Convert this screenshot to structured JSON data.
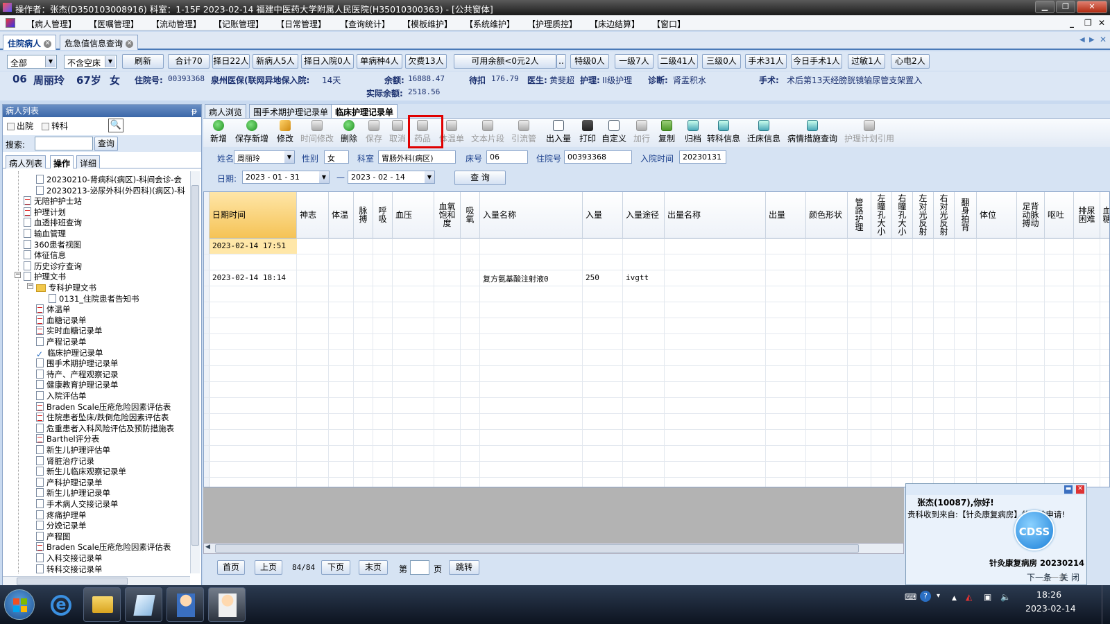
{
  "window": {
    "title": "操作者：张杰(D350103008916)  科室：1-15F  2023-02-14  福建中医药大学附属人民医院(H35010300363) - [公共窗体]",
    "controls": [
      "minimize",
      "restore",
      "close"
    ]
  },
  "menu": {
    "items": [
      "【病人管理】",
      "【医嘱管理】",
      "【流动管理】",
      "【记账管理】",
      "【日常管理】",
      "【查询统计】",
      "【模板维护】",
      "【系统维护】",
      "【护理质控】",
      "【床边结算】",
      "【窗口】"
    ],
    "right_controls": [
      "_",
      "❐",
      "✕"
    ]
  },
  "top_tabs": [
    {
      "label": "住院病人",
      "active": true
    },
    {
      "label": "危急值信息查询",
      "active": false
    }
  ],
  "filter": {
    "scope_value": "全部",
    "bed_value": "不含空床",
    "buttons": [
      "刷新",
      "合计70",
      "择日22人",
      "新病人5人",
      "择日入院0人",
      "单病种4人",
      "欠费13人",
      "可用余额<0元2人",
      "..",
      "特级0人",
      "一级7人",
      "二级41人",
      "三级0人",
      "手术31人",
      "今日手术1人",
      "过敏1人",
      "心电2人"
    ]
  },
  "patient": {
    "bed": "06",
    "name": "周丽玲",
    "age": "67岁",
    "sex": "女",
    "admission_no_label": "住院号:",
    "admission_no": "00393368",
    "insurance": "泉州医保(联网异地保入院:",
    "days": "14天",
    "balance_label": "余额:",
    "balance": "16888.47",
    "pending_label": "待扣",
    "pending": "176.79",
    "actual_balance_label": "实际余额:",
    "actual_balance": "2518.56",
    "doctor_label": "医生:",
    "doctor": "黄斐超",
    "nursing_label": "护理:",
    "nursing": "II级护理",
    "diagnosis_label": "诊断:",
    "diagnosis": "肾盂积水",
    "surgery_label": "手术:",
    "surgery": "术后第13天经膀胱镜输尿管支架置入"
  },
  "left_panel": {
    "header": "病人列表",
    "pin": "ᵽ",
    "discharged_label": "出院",
    "transfer_label": "转科",
    "search_label": "搜索:",
    "search_value": "",
    "query_button": "查询",
    "tabs": [
      {
        "label": "病人列表",
        "active": false
      },
      {
        "label": "操作",
        "active": true
      },
      {
        "label": "详细",
        "active": false
      }
    ],
    "tree": [
      {
        "label": "20230210-肾病科(病区)-科间会诊-会",
        "level": 2,
        "icon": "doc"
      },
      {
        "label": "20230213-泌尿外科(外四科)(病区)-科",
        "level": 2,
        "icon": "doc"
      },
      {
        "label": "无陪护护士站",
        "level": 1,
        "icon": "red"
      },
      {
        "label": "护理计划",
        "level": 1,
        "icon": "red"
      },
      {
        "label": "血透排班查询",
        "level": 1,
        "icon": "doc"
      },
      {
        "label": "输血管理",
        "level": 1,
        "icon": "doc"
      },
      {
        "label": "360患者视图",
        "level": 1,
        "icon": "doc"
      },
      {
        "label": "体征信息",
        "level": 1,
        "icon": "doc"
      },
      {
        "label": "历史诊疗查询",
        "level": 1,
        "icon": "doc"
      },
      {
        "label": "护理文书",
        "level": 1,
        "icon": "doc"
      },
      {
        "label": "专科护理文书",
        "level": 2,
        "icon": "folder"
      },
      {
        "label": "0131_住院患者告知书",
        "level": 3,
        "icon": "doc"
      },
      {
        "label": "体温单",
        "level": 2,
        "icon": "red"
      },
      {
        "label": "血糖记录单",
        "level": 2,
        "icon": "red"
      },
      {
        "label": "实时血糖记录单",
        "level": 2,
        "icon": "red"
      },
      {
        "label": "产程记录单",
        "level": 2,
        "icon": "doc"
      },
      {
        "label": "临床护理记录单",
        "level": 2,
        "icon": "check"
      },
      {
        "label": "围手术期护理记录单",
        "level": 2,
        "icon": "doc"
      },
      {
        "label": "待产、产程观察记录",
        "level": 2,
        "icon": "doc"
      },
      {
        "label": "健康教育护理记录单",
        "level": 2,
        "icon": "doc"
      },
      {
        "label": "入院评估单",
        "level": 2,
        "icon": "doc"
      },
      {
        "label": "Braden Scale压疮危险因素评估表",
        "level": 2,
        "icon": "red"
      },
      {
        "label": "住院患者坠床/跌倒危险因素评估表",
        "level": 2,
        "icon": "red"
      },
      {
        "label": "危重患者入科风险评估及预防措施表",
        "level": 2,
        "icon": "doc"
      },
      {
        "label": "Barthel评分表",
        "level": 2,
        "icon": "red"
      },
      {
        "label": "新生儿护理评估单",
        "level": 2,
        "icon": "doc"
      },
      {
        "label": "肾脏治疗记录",
        "level": 2,
        "icon": "doc"
      },
      {
        "label": "新生儿临床观察记录单",
        "level": 2,
        "icon": "doc"
      },
      {
        "label": "产科护理记录单",
        "level": 2,
        "icon": "doc"
      },
      {
        "label": "新生儿护理记录单",
        "level": 2,
        "icon": "doc"
      },
      {
        "label": "手术病人交接记录单",
        "level": 2,
        "icon": "doc"
      },
      {
        "label": "疼痛护理单",
        "level": 2,
        "icon": "doc"
      },
      {
        "label": "分娩记录单",
        "level": 2,
        "icon": "doc"
      },
      {
        "label": "产程图",
        "level": 2,
        "icon": "doc"
      },
      {
        "label": "Braden Scale压疮危险因素评估表",
        "level": 2,
        "icon": "red"
      },
      {
        "label": "入科交接记录单",
        "level": 2,
        "icon": "doc"
      },
      {
        "label": "转科交接记录单",
        "level": 2,
        "icon": "doc"
      }
    ]
  },
  "sub_tabs": [
    {
      "label": "病人浏览",
      "active": false
    },
    {
      "label": "围手术期护理记录单",
      "active": false
    },
    {
      "label": "临床护理记录单",
      "active": true
    }
  ],
  "toolbar": [
    {
      "label": "新增",
      "icon": "add-icon",
      "enabled": true
    },
    {
      "label": "保存新增",
      "icon": "save-add-icon",
      "enabled": true
    },
    {
      "label": "修改",
      "icon": "edit-icon",
      "enabled": true
    },
    {
      "label": "时间修改",
      "icon": "time-edit-icon",
      "enabled": false
    },
    {
      "label": "删除",
      "icon": "delete-icon",
      "enabled": true
    },
    {
      "label": "保存",
      "icon": "save-icon",
      "enabled": false
    },
    {
      "label": "取消",
      "icon": "undo-icon",
      "enabled": false
    },
    {
      "label": "药品",
      "icon": "drug-icon",
      "enabled": false
    },
    {
      "label": "体温单",
      "icon": "temperature-sheet-icon",
      "enabled": false
    },
    {
      "label": "文本片段",
      "icon": "text-snippet-icon",
      "enabled": false
    },
    {
      "label": "引流管",
      "icon": "drainage-tube-icon",
      "enabled": false
    },
    {
      "label": "出入量",
      "icon": "intake-output-icon",
      "enabled": true
    },
    {
      "label": "打印",
      "icon": "print-icon",
      "enabled": true
    },
    {
      "label": "自定义",
      "icon": "custom-icon",
      "enabled": true
    },
    {
      "label": "加行",
      "icon": "add-row-icon",
      "enabled": false
    },
    {
      "label": "复制",
      "icon": "copy-icon",
      "enabled": true
    },
    {
      "label": "归档",
      "icon": "archive-icon",
      "enabled": true
    },
    {
      "label": "转科信息",
      "icon": "transfer-info-icon",
      "enabled": true
    },
    {
      "label": "迁床信息",
      "icon": "bed-move-icon",
      "enabled": true
    },
    {
      "label": "病情措施查询",
      "icon": "measures-query-icon",
      "enabled": true
    },
    {
      "label": "护理计划引用",
      "icon": "care-plan-icon",
      "enabled": false
    }
  ],
  "form": {
    "name_label": "姓名",
    "name": "周丽玲",
    "sex_label": "性别",
    "sex": "女",
    "dept_label": "科室",
    "dept": "胃肠外科(病区)",
    "bed_label": "床号",
    "bed": "06",
    "adm_label": "住院号",
    "adm": "00393368",
    "adm_time_label": "入院时间",
    "adm_time": "20230131",
    "date_label": "日期:",
    "date_from": "2023 - 01 - 31",
    "date_sep": "—",
    "date_to": "2023 - 02 - 14",
    "query_button": "查 询"
  },
  "grid": {
    "columns": [
      "日期时间",
      "神志",
      "体温",
      "脉搏",
      "呼吸",
      "血压",
      "血氧饱和度",
      "吸氧",
      "入量名称",
      "入量",
      "入量途径",
      "出量名称",
      "出量",
      "颜色形状",
      "管路护理",
      "左瞳孔大小",
      "右瞳孔大小",
      "左对光反射",
      "右对光反射",
      "翻身拍背",
      "体位",
      "足背动脉搏动",
      "呕吐",
      "排尿困难",
      "血糖"
    ],
    "rows": [
      {
        "datetime": "2023-02-14 17:51",
        "intake_name": "",
        "intake": "",
        "route": ""
      },
      {
        "datetime": "",
        "intake_name": "",
        "intake": "",
        "route": ""
      },
      {
        "datetime": "2023-02-14 18:14",
        "intake_name": "复方氨基酸注射液0",
        "intake": "250",
        "route": "ivgtt"
      }
    ]
  },
  "pager": {
    "first": "首页",
    "prev": "上页",
    "status": "84/84",
    "next": "下页",
    "last": "末页",
    "page_label": "第",
    "page_value": "",
    "page_unit": "页",
    "jump": "跳转"
  },
  "popup": {
    "greeting": "张杰(10087),你好!",
    "message": "贵科收到来自:【针灸康复病房】的会诊申请!",
    "badge": "CDSS",
    "source": "针灸康复病房 20230214",
    "prev": "上一条",
    "next": "下一条",
    "close": "关 闭"
  },
  "taskbar": {
    "time": "18:26",
    "date": "2023-02-14"
  }
}
